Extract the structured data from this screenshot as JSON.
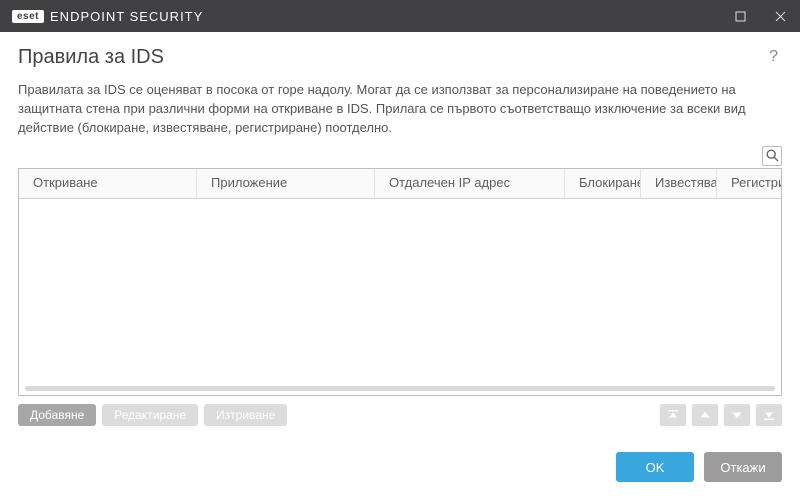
{
  "window": {
    "brand_badge": "eset",
    "brand_text": "ENDPOINT SECURITY"
  },
  "page": {
    "title": "Правила за IDS",
    "help_symbol": "?",
    "description": "Правилата за IDS се оценяват в посока от горе надолу. Могат да се използват за персонализиране на поведението на защитната стена при различни форми на откриване в IDS. Прилага се първото съответстващо изключение за всеки вид действие (блокиране, известяване, регистриране) поотделно."
  },
  "table": {
    "columns": [
      "Откриване",
      "Приложение",
      "Отдалечен IP адрес",
      "Блокиране",
      "Известяване",
      "Регистриране"
    ],
    "rows": []
  },
  "actions": {
    "add": "Добавяне",
    "edit": "Редактиране",
    "delete": "Изтриване"
  },
  "footer": {
    "ok": "OK",
    "cancel": "Откажи"
  }
}
